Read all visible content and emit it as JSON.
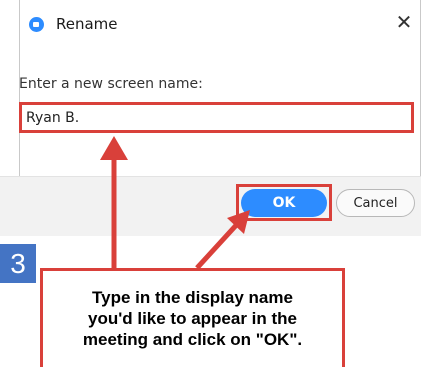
{
  "dialog": {
    "title": "Rename",
    "close_glyph": "✕",
    "icon": "zoom-app-icon",
    "prompt_label": "Enter a new screen name:",
    "name_input_value": "Ryan B.",
    "ok_label": "OK",
    "cancel_label": "Cancel"
  },
  "instruction": {
    "step_number": "3",
    "text": "Type in the display name\nyou'd like to appear in the\nmeeting and click on \"OK\"."
  },
  "colors": {
    "accent_blue": "#2d8cff",
    "highlight_red": "#d9403a",
    "step_badge_blue": "#4474c4"
  }
}
